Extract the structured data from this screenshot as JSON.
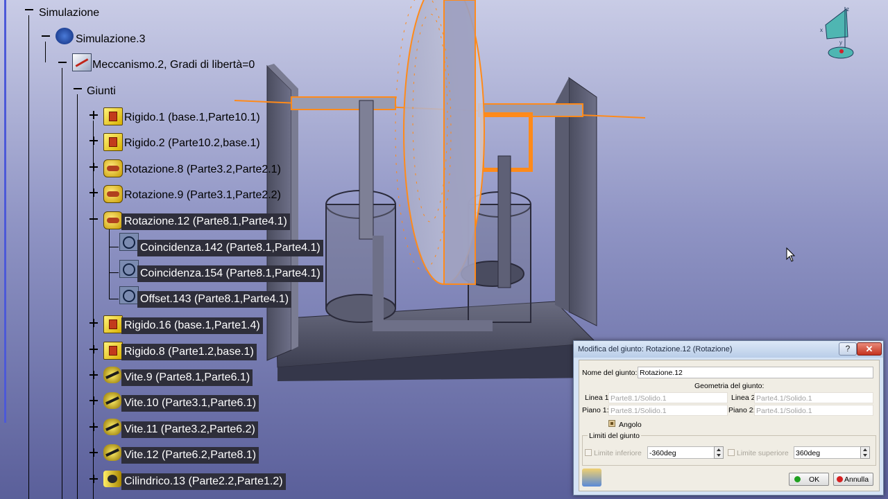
{
  "tree": {
    "root_label": "Simulazione",
    "simulation_label": "Simulazione.3",
    "mechanism_label": "Meccanismo.2, Gradi di libertà=0",
    "joints_label": "Giunti",
    "items": [
      {
        "label": "Rigido.1 (base.1,Parte10.1)"
      },
      {
        "label": "Rigido.2 (Parte10.2,base.1)"
      },
      {
        "label": "Rotazione.8 (Parte3.2,Parte2.1)"
      },
      {
        "label": "Rotazione.9 (Parte3.1,Parte2.2)"
      },
      {
        "label": "Rotazione.12 (Parte8.1,Parte4.1)"
      },
      {
        "label": "Coincidenza.142 (Parte8.1,Parte4.1)"
      },
      {
        "label": "Coincidenza.154 (Parte8.1,Parte4.1)"
      },
      {
        "label": "Offset.143 (Parte8.1,Parte4.1)"
      },
      {
        "label": "Rigido.16 (base.1,Parte1.4)"
      },
      {
        "label": "Rigido.8 (Parte1.2,base.1)"
      },
      {
        "label": "Vite.9 (Parte8.1,Parte6.1)"
      },
      {
        "label": "Vite.10 (Parte3.1,Parte6.1)"
      },
      {
        "label": "Vite.11 (Parte3.2,Parte6.2)"
      },
      {
        "label": "Vite.12 (Parte6.2,Parte8.1)"
      },
      {
        "label": "Cilindrico.13 (Parte2.2,Parte1.2)"
      }
    ]
  },
  "compass": {
    "z": "z",
    "x": "x",
    "y": "y"
  },
  "dialog": {
    "title": "Modifica del giunto: Rotazione.12 (Rotazione)",
    "help": "?",
    "close": "✕",
    "name_label": "Nome del giunto:",
    "name_value": "Rotazione.12",
    "geometry_label": "Geometria del giunto:",
    "line1_label": "Linea 1:",
    "line1_value": "Parte8.1/Solido.1",
    "line2_label": "Linea 2:",
    "line2_value": "Parte4.1/Solido.1",
    "plane1_label": "Piano 1:",
    "plane1_value": "Parte8.1/Solido.1",
    "plane2_label": "Piano 2:",
    "plane2_value": "Parte4.1/Solido.1",
    "angle_label": "Angolo",
    "angle_checked": true,
    "limits_label": "Limiti del giunto",
    "lower_label": "Limite inferiore",
    "lower_value": "-360deg",
    "upper_label": "Limite superiore",
    "upper_value": "360deg",
    "ok_label": "OK",
    "cancel_label": "Annulla"
  },
  "colors": {
    "selection": "#ff8a1a",
    "tree_highlight": "#2e2e3a",
    "ok_dot": "#1fa01f",
    "cancel_dot": "#d62020"
  }
}
